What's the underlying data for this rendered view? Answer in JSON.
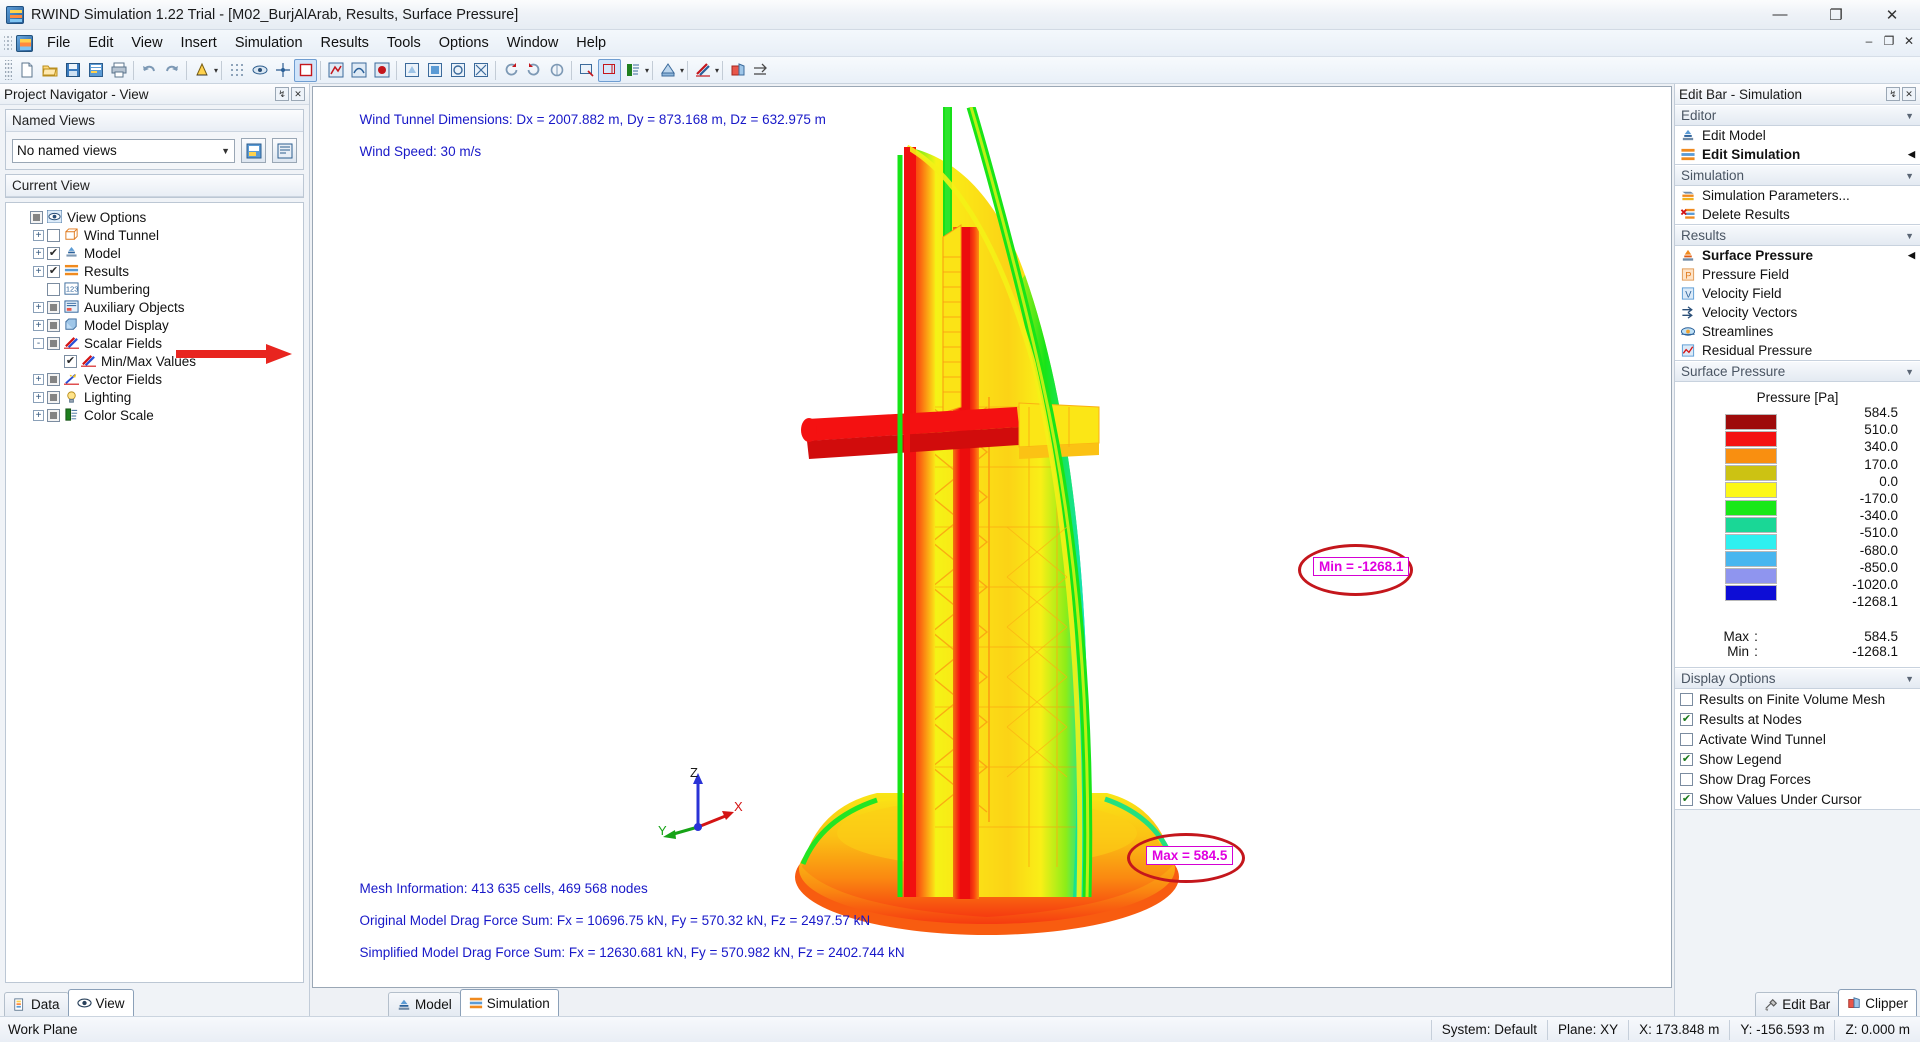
{
  "window": {
    "title": "RWIND Simulation 1.22 Trial - [M02_BurjAlArab, Results, Surface Pressure]",
    "minimize": "—",
    "maximize": "❐",
    "close": "✕",
    "mdi_minimize": "–",
    "mdi_restore": "❐",
    "mdi_close": "✕"
  },
  "menu": {
    "items": [
      "File",
      "Edit",
      "View",
      "Insert",
      "Simulation",
      "Results",
      "Tools",
      "Options",
      "Window",
      "Help"
    ]
  },
  "toolbar": {
    "groups": [
      [
        "new-document",
        "open-folder",
        "save-disk",
        "save-report",
        "print"
      ],
      [
        "undo",
        "redo"
      ],
      [
        "render-mode"
      ],
      [
        "mesh-dots",
        "fvm-mesh",
        "mesh-points",
        "selection-box"
      ],
      [
        "result-1",
        "result-2",
        "result-3"
      ],
      [
        "view-front",
        "view-back",
        "view-top",
        "view-iso"
      ],
      [
        "rotate-left",
        "rotate-right",
        "rotate-free"
      ],
      [
        "zoom-window",
        "zoom-all",
        "color-scale"
      ],
      [
        "display-props"
      ],
      [
        "scalar-fields"
      ],
      [
        "clipper"
      ],
      [
        "measure"
      ]
    ]
  },
  "navigator": {
    "caption": "Project Navigator - View",
    "pin": "↯",
    "close": "✕",
    "named_views": {
      "group_label": "Named Views",
      "selected": "No named views",
      "btn_save": "save-view-icon",
      "btn_manage": "manage-views-icon"
    },
    "current_view": {
      "group_label": "Current View",
      "tree": [
        {
          "label": "View Options",
          "depth": 0,
          "expander": "",
          "check": "grey",
          "icon": "view-options-icon"
        },
        {
          "label": "Wind Tunnel",
          "depth": 1,
          "expander": "+",
          "check": "empty",
          "icon": "wind-tunnel-icon"
        },
        {
          "label": "Model",
          "depth": 1,
          "expander": "+",
          "check": "checked",
          "icon": "model-icon"
        },
        {
          "label": "Results",
          "depth": 1,
          "expander": "+",
          "check": "checked",
          "icon": "results-icon"
        },
        {
          "label": "Numbering",
          "depth": 1,
          "expander": "",
          "check": "empty",
          "icon": "numbering-icon"
        },
        {
          "label": "Auxiliary Objects",
          "depth": 1,
          "expander": "+",
          "check": "grey",
          "icon": "auxiliary-objects-icon"
        },
        {
          "label": "Model Display",
          "depth": 1,
          "expander": "+",
          "check": "grey",
          "icon": "model-display-icon"
        },
        {
          "label": "Scalar Fields",
          "depth": 1,
          "expander": "-",
          "check": "grey",
          "icon": "scalar-fields-icon"
        },
        {
          "label": "Min/Max Values",
          "depth": 2,
          "expander": "",
          "check": "checked",
          "icon": "min-max-values-icon"
        },
        {
          "label": "Vector Fields",
          "depth": 1,
          "expander": "+",
          "check": "grey",
          "icon": "vector-fields-icon"
        },
        {
          "label": "Lighting",
          "depth": 1,
          "expander": "+",
          "check": "grey",
          "icon": "lighting-icon"
        },
        {
          "label": "Color Scale",
          "depth": 1,
          "expander": "+",
          "check": "grey",
          "icon": "color-scale-icon"
        }
      ]
    },
    "bottom_tabs": [
      {
        "label": "Data",
        "icon": "data-icon",
        "active": false
      },
      {
        "label": "View",
        "icon": "eye-icon",
        "active": true
      }
    ]
  },
  "viewport": {
    "top_info_line1": "Wind Tunnel Dimensions: Dx = 2007.882 m, Dy = 873.168 m, Dz = 632.975 m",
    "top_info_line2": "Wind Speed: 30 m/s",
    "bottom_info_line1": "Mesh Information: 413 635 cells, 469 568 nodes",
    "bottom_info_line2": "Original Model Drag Force Sum: Fx = 10696.75 kN, Fy = 570.32 kN, Fz = 2497.57 kN",
    "bottom_info_line3": "Simplified Model Drag Force Sum: Fx = 12630.681 kN, Fy = 570.982 kN, Fz = 2402.744 kN",
    "annotation_min": "Min = -1268.1",
    "annotation_max": "Max = 584.5",
    "axis_x": "X",
    "axis_y": "Y",
    "axis_z": "Z",
    "tabs": [
      {
        "label": "Model",
        "icon": "model-icon",
        "active": false
      },
      {
        "label": "Simulation",
        "icon": "simulation-icon",
        "active": true
      }
    ]
  },
  "editbar": {
    "caption": "Edit Bar - Simulation",
    "pin": "↯",
    "close": "✕",
    "sections": [
      {
        "title": "Editor",
        "items": [
          {
            "label": "Edit Model",
            "icon": "model-icon",
            "bold": false,
            "marker": ""
          },
          {
            "label": "Edit Simulation",
            "icon": "simulation-icon",
            "bold": true,
            "marker": "◀"
          }
        ]
      },
      {
        "title": "Simulation",
        "items": [
          {
            "label": "Simulation Parameters...",
            "icon": "parameters-icon",
            "bold": false,
            "marker": ""
          },
          {
            "label": "Delete Results",
            "icon": "delete-results-icon",
            "bold": false,
            "marker": ""
          }
        ]
      },
      {
        "title": "Results",
        "items": [
          {
            "label": "Surface Pressure",
            "icon": "surface-pressure-icon",
            "bold": true,
            "marker": "◀"
          },
          {
            "label": "Pressure Field",
            "icon": "pressure-field-icon",
            "bold": false,
            "marker": ""
          },
          {
            "label": "Velocity Field",
            "icon": "velocity-field-icon",
            "bold": false,
            "marker": ""
          },
          {
            "label": "Velocity Vectors",
            "icon": "velocity-vectors-icon",
            "bold": false,
            "marker": ""
          },
          {
            "label": "Streamlines",
            "icon": "streamlines-icon",
            "bold": false,
            "marker": ""
          },
          {
            "label": "Residual Pressure",
            "icon": "residual-pressure-icon",
            "bold": false,
            "marker": ""
          }
        ]
      }
    ],
    "legend": {
      "section_title": "Surface Pressure",
      "title": "Pressure [Pa]",
      "max_label": "Max",
      "min_label": "Min",
      "colon": ":",
      "max_value": "584.5",
      "min_value": "-1268.1"
    },
    "display_options": {
      "title": "Display Options",
      "options": [
        {
          "label": "Results on Finite Volume Mesh",
          "checked": false
        },
        {
          "label": "Results at Nodes",
          "checked": true
        },
        {
          "label": "Activate Wind Tunnel",
          "checked": false
        },
        {
          "label": "Show Legend",
          "checked": true
        },
        {
          "label": "Show Drag Forces",
          "checked": false
        },
        {
          "label": "Show Values Under Cursor",
          "checked": true
        }
      ]
    },
    "bottom_tabs": [
      {
        "label": "Edit Bar",
        "icon": "tools-icon",
        "active": false
      },
      {
        "label": "Clipper",
        "icon": "clipper-icon",
        "active": true
      }
    ]
  },
  "statusbar": {
    "left": "Work Plane",
    "cells": [
      "System: Default",
      "Plane: XY",
      "X:  173.848 m",
      "Y:  -156.593 m",
      "Z:  0.000 m"
    ]
  },
  "chart_data": {
    "type": "heatmap",
    "title": "Pressure [Pa]",
    "ylabel": "Pressure [Pa]",
    "legend_position": "right-panel",
    "colors": [
      "#9e0b0b",
      "#f41111",
      "#f98f10",
      "#ccc213",
      "#fcf816",
      "#18e818",
      "#1ad796",
      "#2ef0f0",
      "#48b6ef",
      "#8f95ef",
      "#0d0dd6"
    ],
    "tick_labels": [
      "584.5",
      "510.0",
      "340.0",
      "170.0",
      "0.0",
      "-170.0",
      "-340.0",
      "-510.0",
      "-680.0",
      "-850.0",
      "-1020.0",
      "-1268.1"
    ],
    "values": [
      584.5,
      510.0,
      340.0,
      170.0,
      0.0,
      -170.0,
      -340.0,
      -510.0,
      -680.0,
      -850.0,
      -1020.0,
      -1268.1
    ],
    "max": 584.5,
    "min": -1268.1,
    "units": "Pa"
  }
}
